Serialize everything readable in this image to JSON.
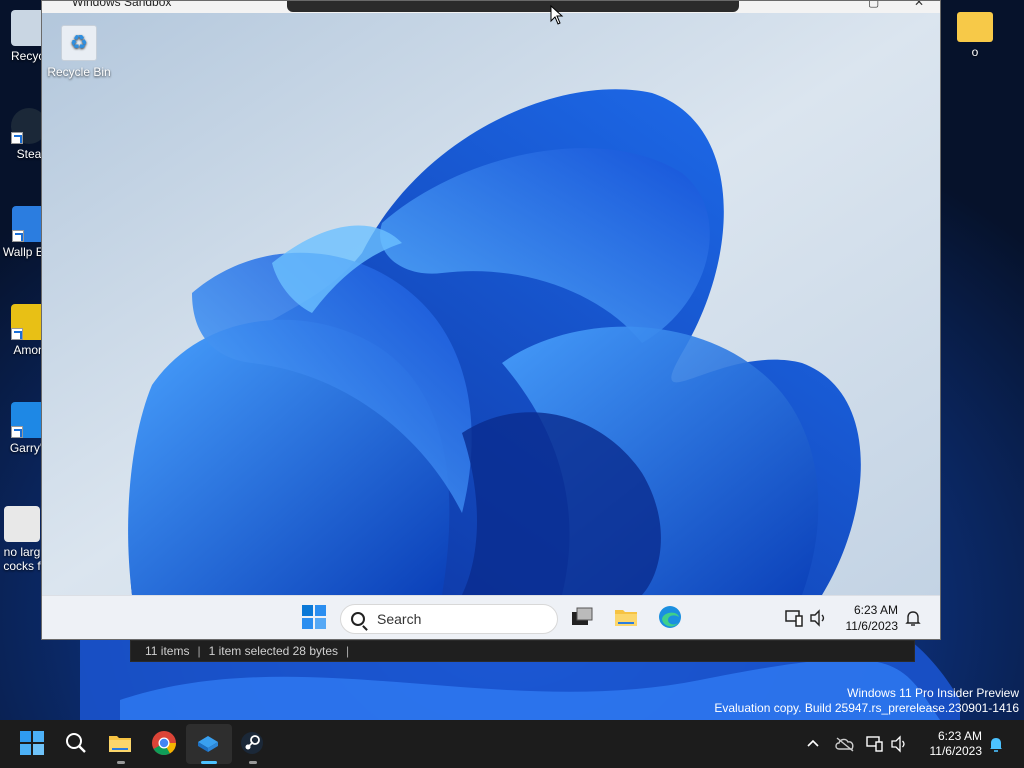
{
  "host_desktop": {
    "icons": [
      {
        "label": "Recycl",
        "icon": "recycle-bin-icon"
      },
      {
        "label": "Stea",
        "icon": "steam-icon"
      },
      {
        "label": "Wallp Eng",
        "icon": "wallpaper-engine-icon"
      },
      {
        "label": "Amon",
        "icon": "among-us-icon"
      },
      {
        "label": "Garry's",
        "icon": "garrys-mod-icon"
      },
      {
        "label": "no larg cocks f",
        "icon": "settings-file-icon"
      },
      {
        "label": "o",
        "icon": "folder-icon"
      }
    ],
    "watermark": {
      "line1": "Windows 11 Pro Insider Preview",
      "line2": "Evaluation copy. Build 25947.rs_prerelease.230901-1416"
    }
  },
  "explorer_status": {
    "items": "11 items",
    "selected": "1 item selected  28 bytes",
    "sep": "|"
  },
  "sandbox_window": {
    "title": "Windows Sandbox",
    "desktop_icon": {
      "label": "Recycle Bin",
      "icon": "recycle-bin-icon"
    },
    "taskbar": {
      "search_placeholder": "Search",
      "time": "6:23 AM",
      "date": "11/6/2023"
    }
  },
  "host_taskbar": {
    "time": "6:23 AM",
    "date": "11/6/2023"
  },
  "colors": {
    "accent": "#0067c0",
    "bloom": "#1a5fe0",
    "taskbar_dark": "#1c1c1c"
  }
}
